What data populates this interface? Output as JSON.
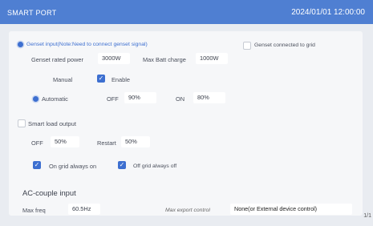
{
  "header": {
    "title": "SMART PORT",
    "datetime": "2024/01/01 12:00:00"
  },
  "genset": {
    "input_label": "Genset input(Note:Need to connect genset signal)",
    "connected_label": "Genset connected to grid",
    "rated_power_label": "Genset rated power",
    "rated_power_value": "3000W",
    "max_batt_label": "Max Batt charge",
    "max_batt_value": "1000W",
    "manual_label": "Manual",
    "enable_label": "Enable",
    "automatic_label": "Automatic",
    "off_label": "OFF",
    "off_value": "90%",
    "on_label": "ON",
    "on_value": "80%"
  },
  "smart_load": {
    "label": "Smart load output",
    "off_label": "OFF",
    "off_value": "50%",
    "restart_label": "Restart",
    "restart_value": "50%",
    "on_grid_label": "On grid always on",
    "off_grid_label": "Off grid always off"
  },
  "ac_couple": {
    "label": "AC-couple input",
    "max_freq_label": "Max freq",
    "max_freq_value": "60.5Hz",
    "max_export_label": "Max export control",
    "max_export_value": "None(or External device control)"
  },
  "pager": "1/1"
}
